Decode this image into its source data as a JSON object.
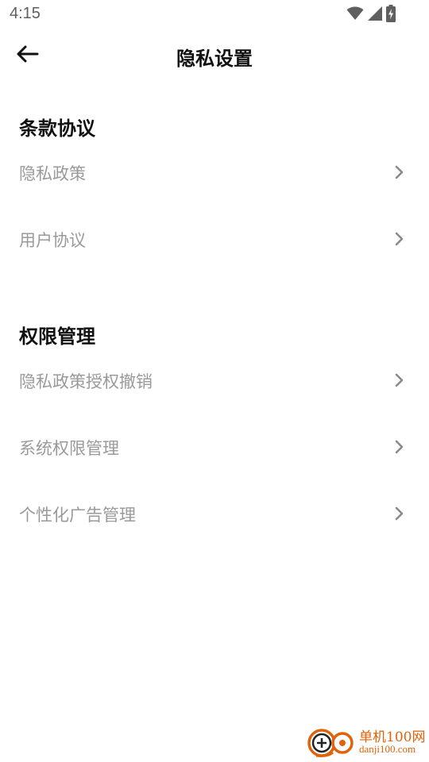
{
  "status_bar": {
    "time": "4:15",
    "icons": [
      "wifi-icon",
      "signal-icon",
      "battery-charging-icon"
    ]
  },
  "header": {
    "back_icon": "arrow-left-icon",
    "title": "隐私设置"
  },
  "sections": [
    {
      "title": "条款协议",
      "items": [
        {
          "label": "隐私政策",
          "icon": "chevron-right-icon"
        },
        {
          "label": "用户协议",
          "icon": "chevron-right-icon"
        }
      ]
    },
    {
      "title": "权限管理",
      "items": [
        {
          "label": "隐私政策授权撤销",
          "icon": "chevron-right-icon"
        },
        {
          "label": "系统权限管理",
          "icon": "chevron-right-icon"
        },
        {
          "label": "个性化广告管理",
          "icon": "chevron-right-icon"
        }
      ]
    }
  ],
  "watermark": {
    "name": "单机100网",
    "url": "danji100.com"
  },
  "colors": {
    "title_text": "#111111",
    "item_text": "#9a9a9a",
    "chevron": "#8a8a8a",
    "watermark": "#e0620a"
  }
}
